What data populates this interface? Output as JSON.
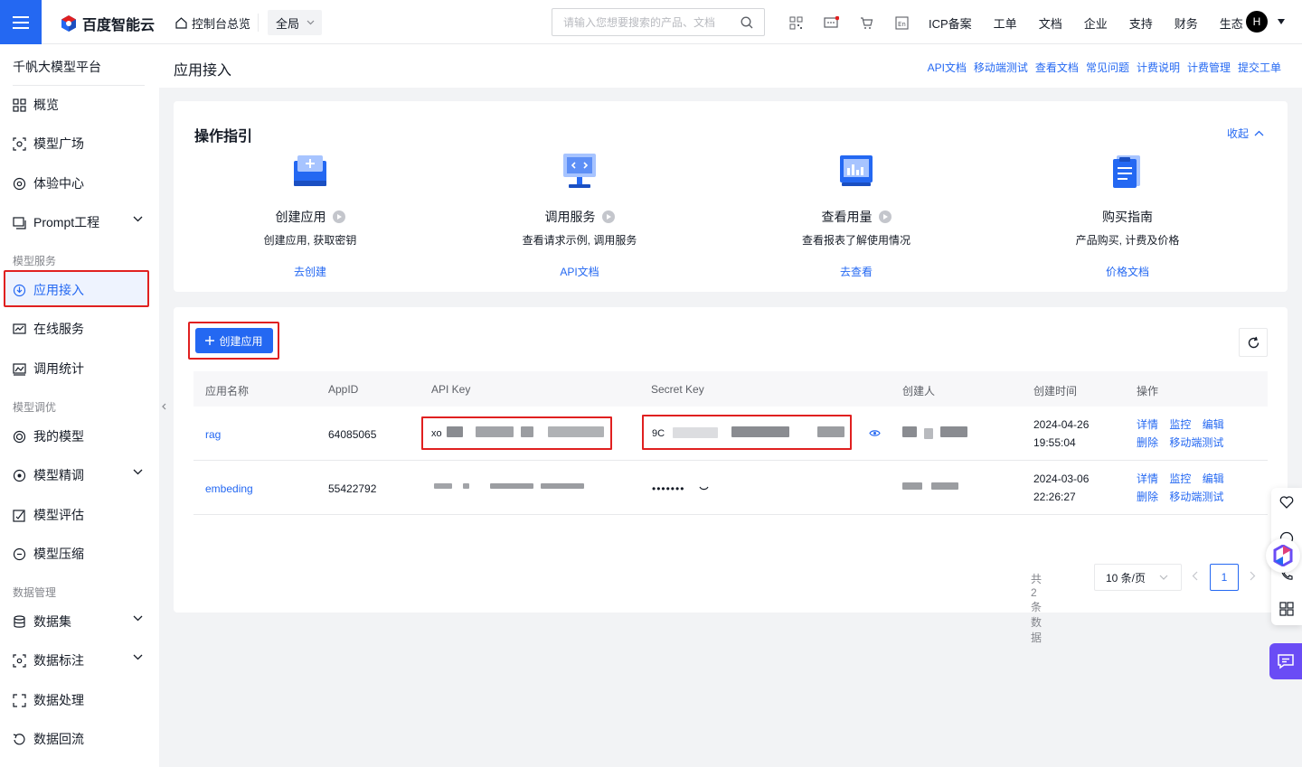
{
  "brand": {
    "name": "百度智能云",
    "accent": "#2468f2"
  },
  "topbar": {
    "console_home": "控制台总览",
    "region": "全局",
    "search_placeholder": "请输入您想要搜索的产品、文档",
    "nav": [
      "ICP备案",
      "工单",
      "文档",
      "企业",
      "支持",
      "财务",
      "生态"
    ],
    "avatar_letter": "H",
    "icons": [
      "qrcode-icon",
      "message-icon",
      "cart-icon",
      "language-icon"
    ]
  },
  "sidebar": {
    "title": "千帆大模型平台",
    "items": [
      {
        "label": "概览",
        "icon": "grid-icon"
      },
      {
        "label": "模型广场",
        "icon": "model-icon"
      },
      {
        "label": "体验中心",
        "icon": "experience-icon"
      },
      {
        "label": "Prompt工程",
        "icon": "prompt-icon"
      }
    ],
    "group_model_service": "模型服务",
    "service_items": [
      {
        "label": "应用接入",
        "icon": "app-access-icon"
      },
      {
        "label": "在线服务",
        "icon": "online-service-icon"
      },
      {
        "label": "调用统计",
        "icon": "stats-icon"
      }
    ],
    "group_model_tuning": "模型调优",
    "tuning_items": [
      {
        "label": "我的模型",
        "icon": "my-model-icon"
      },
      {
        "label": "模型精调",
        "icon": "finetune-icon"
      },
      {
        "label": "模型评估",
        "icon": "evaluate-icon"
      },
      {
        "label": "模型压缩",
        "icon": "compress-icon"
      }
    ],
    "group_data": "数据管理",
    "data_items": [
      {
        "label": "数据集",
        "icon": "dataset-icon"
      },
      {
        "label": "数据标注",
        "icon": "annotate-icon"
      },
      {
        "label": "数据处理",
        "icon": "process-icon"
      },
      {
        "label": "数据回流",
        "icon": "backflow-icon"
      }
    ]
  },
  "header": {
    "title": "应用接入",
    "links": [
      "API文档",
      "移动端测试",
      "查看文档",
      "常见问题",
      "计费说明",
      "计费管理",
      "提交工单"
    ]
  },
  "guide": {
    "title": "操作指引",
    "collapse": "收起",
    "steps": [
      {
        "name": "创建应用",
        "desc": "创建应用, 获取密钥",
        "link": "去创建"
      },
      {
        "name": "调用服务",
        "desc": "查看请求示例, 调用服务",
        "link": "API文档"
      },
      {
        "name": "查看用量",
        "desc": "查看报表了解使用情况",
        "link": "去查看"
      },
      {
        "name": "购买指南",
        "desc": "产品购买, 计费及价格",
        "link": "价格文档"
      }
    ]
  },
  "table": {
    "create_button": "创建应用",
    "columns": [
      "应用名称",
      "AppID",
      "API Key",
      "Secret Key",
      "创建人",
      "创建时间",
      "操作"
    ],
    "rows": [
      {
        "name": "rag",
        "appid": "64085065",
        "api_key": "xo",
        "secret_key": "9C",
        "date": "2024-04-26",
        "time": "19:55:04"
      },
      {
        "name": "embeding",
        "appid": "55422792",
        "api_key": "",
        "secret_key": "•••••••",
        "date": "2024-03-06",
        "time": "22:26:27"
      }
    ],
    "ops_line1": [
      "详情",
      "监控",
      "编辑"
    ],
    "ops_line2": [
      "删除",
      "移动端测试"
    ]
  },
  "pagination": {
    "total": "共2条数据",
    "page_size": "10 条/页",
    "current_page": "1"
  }
}
